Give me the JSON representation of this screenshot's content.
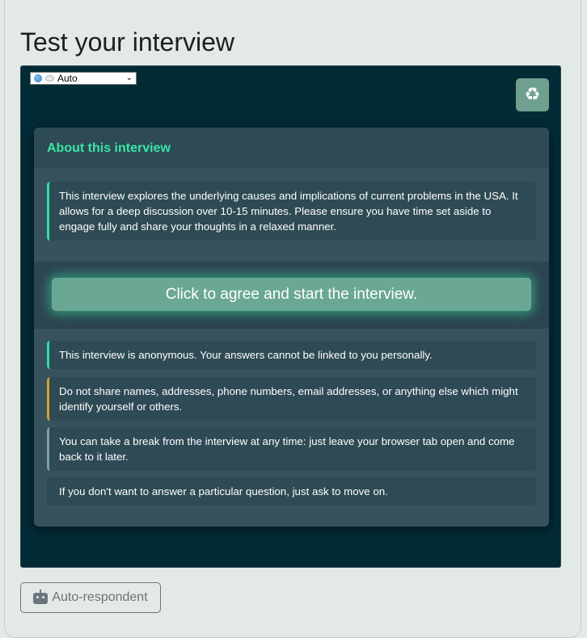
{
  "page": {
    "title": "Test your interview"
  },
  "language_select": {
    "selected": "Auto"
  },
  "reset_button": {
    "icon": "recycle-icon",
    "glyph": "♻"
  },
  "consent": {
    "header": "About this interview",
    "intro": "This interview explores the underlying causes and implications of current problems in the USA. It allows for a deep discussion over 10-15 minutes. Please ensure you have time set aside to engage fully and share your thoughts in a relaxed manner.",
    "agree_label": "Click to agree and start the interview.",
    "notes": [
      "This interview is anonymous. Your answers cannot be linked to you personally.",
      "Do not share names, addresses, phone numbers, email addresses, or anything else which might identify yourself or others.",
      "You can take a break from the interview at any time: just leave your browser tab open and come back to it later.",
      "If you don't want to answer a particular question, just ask to move on."
    ]
  },
  "auto_respondent": {
    "label": "Auto-respondent",
    "icon": "robot-icon"
  },
  "colors": {
    "accent": "#38e6a4",
    "panel_bg": "#032b36",
    "card_bg": "#37525d",
    "button_bg": "#6aa795",
    "warning": "#d3a22f"
  }
}
